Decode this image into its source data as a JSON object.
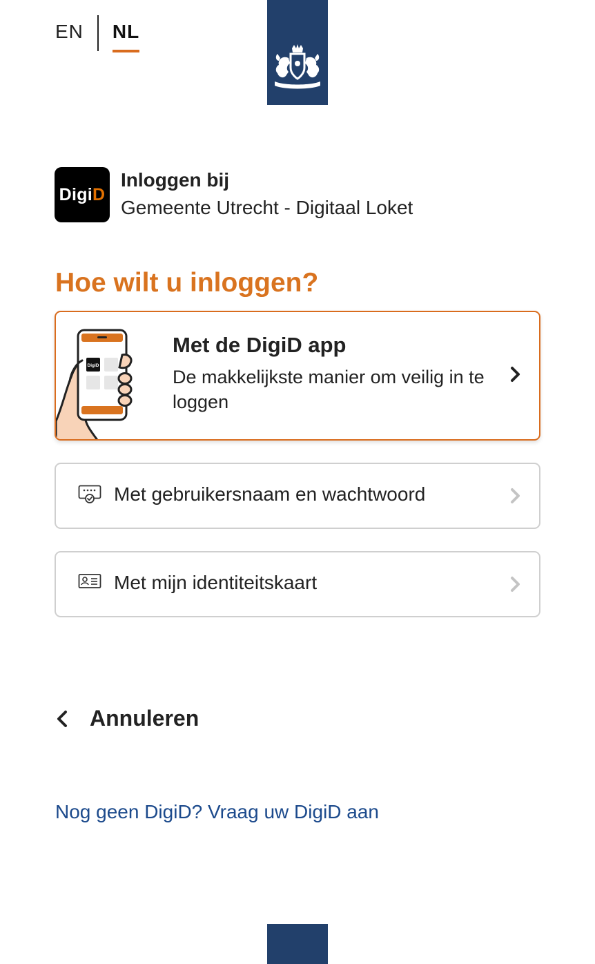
{
  "language": {
    "options": [
      "EN",
      "NL"
    ],
    "active": "NL"
  },
  "header": {
    "logo": {
      "prefix": "Digi",
      "accent": "D"
    },
    "login_label": "Inloggen bij",
    "organisation": "Gemeente Utrecht - Digitaal Loket"
  },
  "main": {
    "question": "Hoe wilt u inloggen?",
    "options": [
      {
        "title": "Met de DigiD app",
        "description": "De makkelijkste manier om veilig in te loggen",
        "icon": "phone-hand-illustration",
        "highlighted": true
      },
      {
        "title": "Met gebruikersnaam en wachtwoord",
        "icon": "password-icon",
        "highlighted": false
      },
      {
        "title": "Met mijn identiteitskaart",
        "icon": "id-card-icon",
        "highlighted": false
      }
    ],
    "phone_logo_text": "DigiD"
  },
  "cancel": {
    "label": "Annuleren",
    "icon": "chevron-left-icon"
  },
  "signup": {
    "label": "Nog geen DigiD? Vraag uw DigiD aan"
  },
  "colors": {
    "brand_orange": "#d9731f",
    "ribbon_blue": "#22406b",
    "link_blue": "#1c4a8c",
    "border_grey": "#cfcfcf"
  }
}
